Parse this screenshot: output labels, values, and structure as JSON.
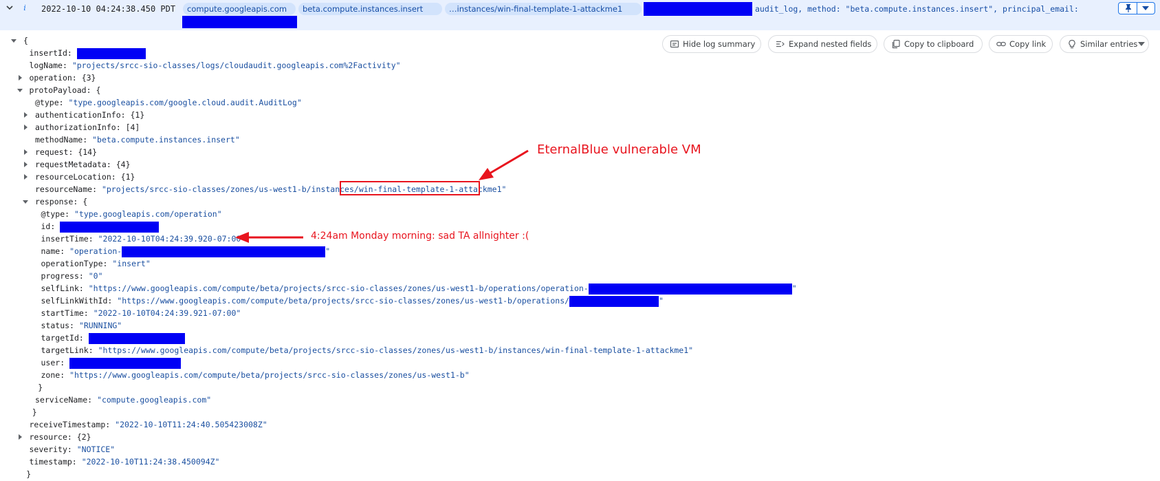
{
  "header": {
    "timestamp": "2022-10-10 04:24:38.450 PDT",
    "chips": [
      "compute.googleapis.com",
      "beta.compute.instances.insert",
      "…instances/win-final-template-1-attackme1"
    ],
    "summary_tail": "audit_log, method: \"beta.compute.instances.insert\", principal_email:",
    "icons": [
      "chevron-down-icon",
      "info-icon",
      "pin-icon",
      "dropdown-arrow-icon"
    ]
  },
  "toolbar": {
    "hide_summary": "Hide log summary",
    "expand_nested": "Expand nested fields",
    "copy_clipboard": "Copy to clipboard",
    "copy_link": "Copy link",
    "similar_entries": "Similar entries"
  },
  "log": [
    {
      "k": "{",
      "v": "",
      "indent": 0,
      "tri": "open"
    },
    {
      "k": "insertId:",
      "v": "",
      "indent": 1,
      "redact": 100
    },
    {
      "k": "logName:",
      "v": "\"projects/srcc-sio-classes/logs/cloudaudit.googleapis.com%2Factivity\"",
      "indent": 1
    },
    {
      "k": "operation:",
      "v": "{3}",
      "indent": 1,
      "tri": "closed",
      "plain": true
    },
    {
      "k": "protoPayload:",
      "v": "{",
      "indent": 1,
      "tri": "open",
      "plain": true
    },
    {
      "k": "@type:",
      "v": "\"type.googleapis.com/google.cloud.audit.AuditLog\"",
      "indent": 2
    },
    {
      "k": "authenticationInfo:",
      "v": "{1}",
      "indent": 2,
      "tri": "closed",
      "plain": true
    },
    {
      "k": "authorizationInfo:",
      "v": "[4]",
      "indent": 2,
      "tri": "closed",
      "plain": true
    },
    {
      "k": "methodName:",
      "v": "\"beta.compute.instances.insert\"",
      "indent": 2
    },
    {
      "k": "request:",
      "v": "{14}",
      "indent": 2,
      "tri": "closed",
      "plain": true
    },
    {
      "k": "requestMetadata:",
      "v": "{4}",
      "indent": 2,
      "tri": "closed",
      "plain": true
    },
    {
      "k": "resourceLocation:",
      "v": "{1}",
      "indent": 2,
      "tri": "closed",
      "plain": true
    },
    {
      "k": "resourceName:",
      "v": "\"projects/srcc-sio-classes/zones/us-west1-b/instances/win-final-template-1-attackme1\"",
      "indent": 2
    },
    {
      "k": "response:",
      "v": "{",
      "indent": 2,
      "tri": "open",
      "plain": true
    },
    {
      "k": "@type:",
      "v": "\"type.googleapis.com/operation\"",
      "indent": 3
    },
    {
      "k": "id:",
      "v": "",
      "indent": 3,
      "redact": 144
    },
    {
      "k": "insertTime:",
      "v": "\"2022-10-10T04:24:39.920-07:00\"",
      "indent": 3
    },
    {
      "k": "name:",
      "v": "\"operation-",
      "indent": 3,
      "redact": 296,
      "after": "\""
    },
    {
      "k": "operationType:",
      "v": "\"insert\"",
      "indent": 3
    },
    {
      "k": "progress:",
      "v": "\"0\"",
      "indent": 3
    },
    {
      "k": "selfLink:",
      "v": "\"https://www.googleapis.com/compute/beta/projects/srcc-sio-classes/zones/us-west1-b/operations/operation-",
      "indent": 3,
      "redact": 296,
      "after": "\""
    },
    {
      "k": "selfLinkWithId:",
      "v": "\"https://www.googleapis.com/compute/beta/projects/srcc-sio-classes/zones/us-west1-b/operations/",
      "indent": 3,
      "redact": 130,
      "after": "\""
    },
    {
      "k": "startTime:",
      "v": "\"2022-10-10T04:24:39.921-07:00\"",
      "indent": 3
    },
    {
      "k": "status:",
      "v": "\"RUNNING\"",
      "indent": 3
    },
    {
      "k": "targetId:",
      "v": "",
      "indent": 3,
      "redact": 140
    },
    {
      "k": "targetLink:",
      "v": "\"https://www.googleapis.com/compute/beta/projects/srcc-sio-classes/zones/us-west1-b/instances/win-final-template-1-attackme1\"",
      "indent": 3
    },
    {
      "k": "user:",
      "v": "",
      "indent": 3,
      "redact": 162
    },
    {
      "k": "zone:",
      "v": "\"https://www.googleapis.com/compute/beta/projects/srcc-sio-classes/zones/us-west1-b\"",
      "indent": 3
    },
    {
      "k": "}",
      "v": "",
      "indent": 2.5
    },
    {
      "k": "serviceName:",
      "v": "\"compute.googleapis.com\"",
      "indent": 2
    },
    {
      "k": "}",
      "v": "",
      "indent": 1.5
    },
    {
      "k": "receiveTimestamp:",
      "v": "\"2022-10-10T11:24:40.505423008Z\"",
      "indent": 1
    },
    {
      "k": "resource:",
      "v": "{2}",
      "indent": 1,
      "tri": "closed",
      "plain": true
    },
    {
      "k": "severity:",
      "v": "\"NOTICE\"",
      "indent": 1
    },
    {
      "k": "timestamp:",
      "v": "\"2022-10-10T11:24:38.450094Z\"",
      "indent": 1
    },
    {
      "k": "}",
      "v": "",
      "indent": 0.5
    }
  ],
  "annotations": {
    "vm_label": "EternalBlue vulnerable VM",
    "time_label": "4:24am Monday morning: sad TA allnighter :(",
    "color": "#e8141e"
  },
  "colors": {
    "header_bg": "#e8f0fe",
    "chip_bg": "#d2e3fc",
    "value_text": "#1a4fa0",
    "redaction": "#0000f5"
  }
}
